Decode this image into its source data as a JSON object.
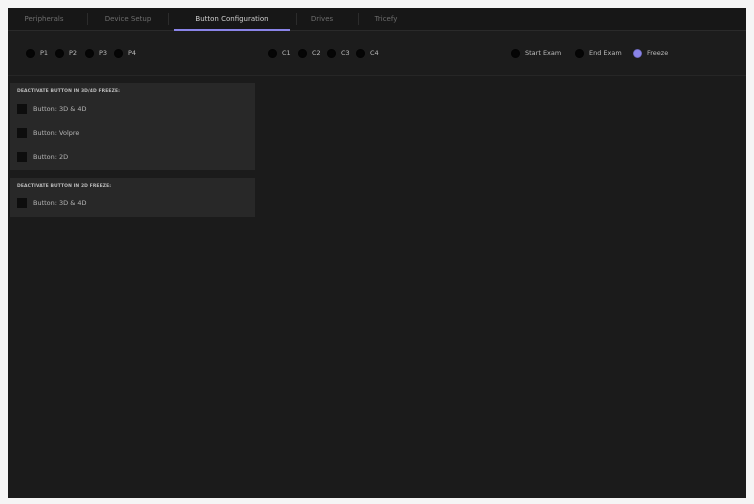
{
  "tabs": [
    {
      "label": "Peripherals",
      "active": false
    },
    {
      "label": "Device Setup",
      "active": false
    },
    {
      "label": "Button Configuration",
      "active": true
    },
    {
      "label": "Drives",
      "active": false
    },
    {
      "label": "Tricefy",
      "active": false
    }
  ],
  "probe_buttons": {
    "p": [
      "P1",
      "P2",
      "P3",
      "P4"
    ],
    "c": [
      "C1",
      "C2",
      "C3",
      "C4"
    ]
  },
  "exam_buttons": [
    {
      "label": "Start Exam",
      "selected": false
    },
    {
      "label": "End Exam",
      "selected": false
    },
    {
      "label": "Freeze",
      "selected": true
    }
  ],
  "panels": [
    {
      "title": "DEACTIVATE BUTTON IN 3D/4D FREEZE:",
      "items": [
        {
          "label": "Button: 3D & 4D",
          "checked": false
        },
        {
          "label": "Button: Volpre",
          "checked": false
        },
        {
          "label": "Button: 2D",
          "checked": false
        }
      ]
    },
    {
      "title": "DEACTIVATE BUTTON IN 2D FREEZE:",
      "items": [
        {
          "label": "Button: 3D & 4D",
          "checked": false
        }
      ]
    }
  ],
  "colors": {
    "background": "#1b1b1b",
    "panel": "#282828",
    "accent": "#8a84e8"
  }
}
